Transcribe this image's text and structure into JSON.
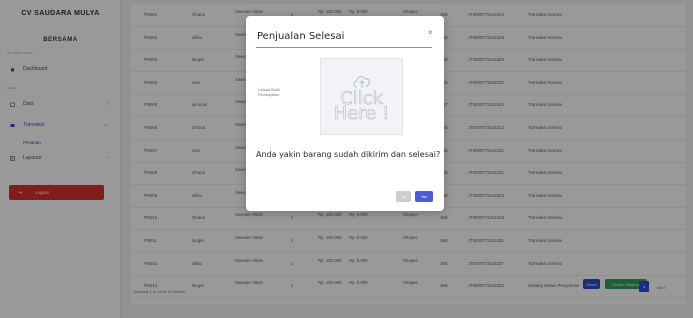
{
  "sidebar": {
    "brand": "CV SAUDARA MULYA",
    "user": "BERSAMA",
    "section_menu": "HALAMAN UTAMA",
    "dashboard": "Dashboard",
    "section_main": "MENU",
    "data": "Data",
    "transaksi": "Transaksi",
    "submenu_pesanan": "Pesanan",
    "laporan": "Laporan",
    "logout": "Logout"
  },
  "table": {
    "rows": [
      {
        "id": "PN001",
        "nama": "Ghana",
        "produk": "Sweater Hitam",
        "qty": "1",
        "harga": "Rp. 100.000",
        "ongkir": "Rp. 9.000",
        "kurir": "Shopee",
        "kode": "JNE",
        "resi": "JT0000773314314",
        "status": "Transaksi Selesai"
      },
      {
        "id": "PN002",
        "nama": "alfiko",
        "produk": "Sweater Hitam",
        "qty": "1",
        "harga": "Rp. 100.000",
        "ongkir": "Rp. 9.000",
        "kurir": "Shopee",
        "kode": "JNE",
        "resi": "JT0000773314328",
        "status": "Transaksi Selesai"
      },
      {
        "id": "PN003",
        "nama": "langet",
        "produk": "Sweater Hitam",
        "qty": "1",
        "harga": "Rp. 100.000",
        "ongkir": "Rp. 9.000",
        "kurir": "Shopee",
        "kode": "JNE",
        "resi": "JT0000773314329",
        "status": "Transaksi Selesai"
      },
      {
        "id": "PN004",
        "nama": "ivan",
        "produk": "Sweater Hitam",
        "qty": "1",
        "harga": "Rp. 100.000",
        "ongkir": "Rp. 9.000",
        "kurir": "Shopee",
        "kode": "JNE",
        "resi": "JT0000773314330",
        "status": "Transaksi Selesai"
      },
      {
        "id": "PN005",
        "nama": "aa iman",
        "produk": "Sweater Hitam",
        "qty": "1",
        "harga": "Rp. 100.000",
        "ongkir": "Rp. 9.000",
        "kurir": "Shopee",
        "kode": "JNT",
        "resi": "JT0000773314284",
        "status": "Transaksi Selesai"
      },
      {
        "id": "PN006",
        "nama": "Ghana",
        "produk": "Sweater Hitam",
        "qty": "1",
        "harga": "Rp. 100.000",
        "ongkir": "Rp. 9.000",
        "kurir": "Shopee",
        "kode": "JNE",
        "resi": "JT0000773314322",
        "status": "Transaksi Selesai"
      },
      {
        "id": "PN007",
        "nama": "ivan",
        "produk": "Sweater Hitam",
        "qty": "1",
        "harga": "Rp. 100.000",
        "ongkir": "Rp. 9.000",
        "kurir": "Shopee",
        "kode": "JNE",
        "resi": "JT0000773314321",
        "status": "Transaksi Selesai"
      },
      {
        "id": "PN008",
        "nama": "Ghana",
        "produk": "Sweater Hitam",
        "qty": "1",
        "harga": "Rp. 100.000",
        "ongkir": "Rp. 9.000",
        "kurir": "Shopee",
        "kode": "JNE",
        "resi": "JT0000773314321",
        "status": "Transaksi Selesai"
      },
      {
        "id": "PN009",
        "nama": "alfiko",
        "produk": "Sweater Hitam",
        "qty": "1",
        "harga": "Rp. 100.000",
        "ongkir": "Rp. 9.000",
        "kurir": "Shopee",
        "kode": "JNE",
        "resi": "JT0000773314323",
        "status": "Transaksi Selesai"
      },
      {
        "id": "PN010",
        "nama": "Ghana",
        "produk": "Sweater Hitam",
        "qty": "1",
        "harga": "Rp. 100.000",
        "ongkir": "Rp. 9.000",
        "kurir": "Shopee",
        "kode": "JNE",
        "resi": "JT0000773314328",
        "status": "Transaksi Selesai"
      },
      {
        "id": "PN011",
        "nama": "langet",
        "produk": "Sweater Hitam",
        "qty": "1",
        "harga": "Rp. 100.000",
        "ongkir": "Rp. 9.000",
        "kurir": "Shopee",
        "kode": "JNE",
        "resi": "JT0000773314331",
        "status": "Transaksi Selesai"
      },
      {
        "id": "PN012",
        "nama": "alfiko",
        "produk": "Sweater Hitam",
        "qty": "1",
        "harga": "Rp. 100.000",
        "ongkir": "Rp. 9.000",
        "kurir": "Shopee",
        "kode": "JNE",
        "resi": "JT0000773314337",
        "status": "Transaksi Selesai"
      },
      {
        "id": "PN013",
        "nama": "langet",
        "produk": "Sweater Hitam",
        "qty": "1",
        "harga": "Rp. 100.000",
        "ongkir": "Rp. 9.000",
        "kurir": "Shopee",
        "kode": "JNE",
        "resi": "JT0000773314332",
        "status": "Sedang Dalam Pengiriman"
      }
    ],
    "action_detail": "Detail",
    "action_finish": "Sudah Diterima",
    "footer_info": "Showing 1 to 13 of 13 entries",
    "pager_prev": "Previous",
    "pager_page": "1",
    "pager_next": "Next"
  },
  "modal": {
    "title": "Penjualan Selesai",
    "close": "×",
    "upload_label": "Upload Bukti Pembayaran",
    "upload_text": "Click Here !",
    "question": "Anda yakin barang sudah dikirim dan selesai?",
    "no_label": "No",
    "yes_label": "Yes"
  },
  "colors": {
    "primary": "#2c4cd1",
    "danger": "#d9312f",
    "success": "#2f9e5a",
    "overlay": "rgba(0,0,0,0.40)"
  }
}
